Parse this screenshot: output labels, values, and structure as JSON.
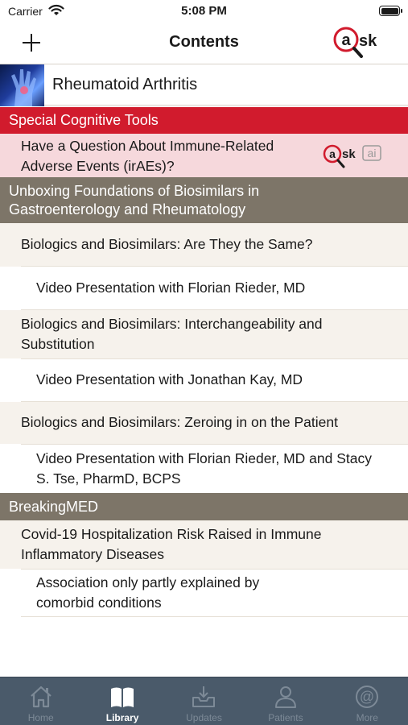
{
  "status_bar": {
    "carrier": "Carrier",
    "time": "5:08 PM"
  },
  "nav": {
    "title": "Contents"
  },
  "header": {
    "label": "Rheumatoid Arthritis"
  },
  "sections": {
    "special": "Special Cognitive Tools",
    "biosimilars": [
      "Unboxing Foundations of Biosimilars in",
      "Gastroenterology and Rheumatology"
    ],
    "breaking": "BreakingMED"
  },
  "items": {
    "ask_question": [
      "Have a Question About Immune-Related",
      "Adverse Events (irAEs)?"
    ],
    "same": "Biologics and Biosimilars: Are They the Same?",
    "same_video": "Video Presentation with Florian Rieder, MD",
    "interchange": [
      "Biologics and Biosimilars: Interchangeability and",
      "Substitution"
    ],
    "interchange_video": "Video Presentation with Jonathan Kay, MD",
    "zeroing": "Biologics and Biosimilars: Zeroing in on the Patient",
    "zeroing_video": [
      "Video Presentation with Florian Rieder, MD and Stacy",
      "S. Tse, PharmD, BCPS"
    ],
    "covid": [
      "Covid-19 Hospitalization Risk Raised in Immune",
      "Inflammatory Diseases"
    ],
    "covid_sub": [
      "Association only partly explained by",
      "comorbid conditions"
    ]
  },
  "tabs": [
    {
      "label": "Home",
      "icon": "home-icon",
      "active": false
    },
    {
      "label": "Library",
      "icon": "book-icon",
      "active": true
    },
    {
      "label": "Updates",
      "icon": "inbox-download-icon",
      "active": false
    },
    {
      "label": "Patients",
      "icon": "person-icon",
      "active": false
    },
    {
      "label": "More",
      "icon": "at-sign-icon",
      "active": false
    }
  ],
  "colors": {
    "section_red": "#d11b2d",
    "section_grey": "#7d7568",
    "row_tan": "#f6f2ec",
    "row_pink": "#f6d8dc",
    "tab_bar": "#4a5a6a"
  }
}
